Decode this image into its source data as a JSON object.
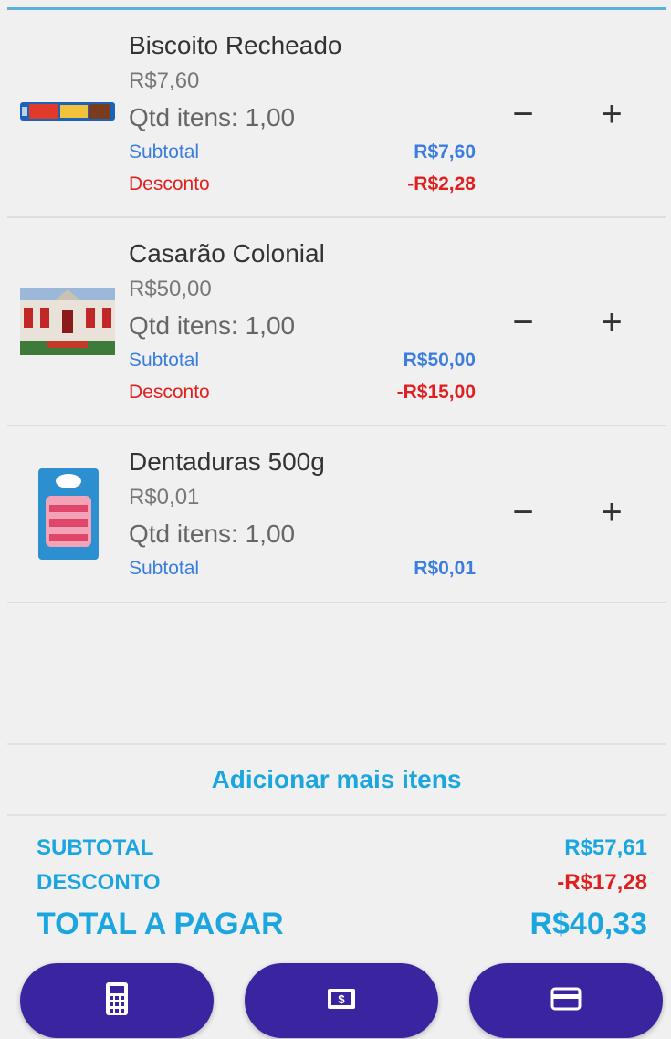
{
  "cart": {
    "items": [
      {
        "name": "Biscoito Recheado",
        "unit_price": "R$7,60",
        "quantity": "Qtd itens: 1,00",
        "subtotal_label": "Subtotal",
        "subtotal_value": "R$7,60",
        "discount_label": "Desconto",
        "discount_value": "-R$2,28",
        "minus_label": "−",
        "plus_label": "+"
      },
      {
        "name": "Casarão Colonial",
        "unit_price": "R$50,00",
        "quantity": "Qtd itens: 1,00",
        "subtotal_label": "Subtotal",
        "subtotal_value": "R$50,00",
        "discount_label": "Desconto",
        "discount_value": "-R$15,00",
        "minus_label": "−",
        "plus_label": "+"
      },
      {
        "name": "Dentaduras 500g",
        "unit_price": "R$0,01",
        "quantity": "Qtd itens: 1,00",
        "subtotal_label": "Subtotal",
        "subtotal_value": "R$0,01",
        "minus_label": "−",
        "plus_label": "+"
      }
    ]
  },
  "add_more": "Adicionar mais itens",
  "summary": {
    "subtotal_label": "SUBTOTAL",
    "subtotal_value": "R$57,61",
    "discount_label": "DESCONTO",
    "discount_value": "-R$17,28",
    "total_label": "TOTAL A PAGAR",
    "total_value": "R$40,33"
  },
  "actions": {
    "icons": [
      "calculator-icon",
      "cash-icon",
      "credit-card-icon"
    ]
  },
  "colors": {
    "accent": "#1ba6e0",
    "button": "#3b24a0",
    "discount": "#e02020",
    "subtotal": "#3c7de0"
  }
}
